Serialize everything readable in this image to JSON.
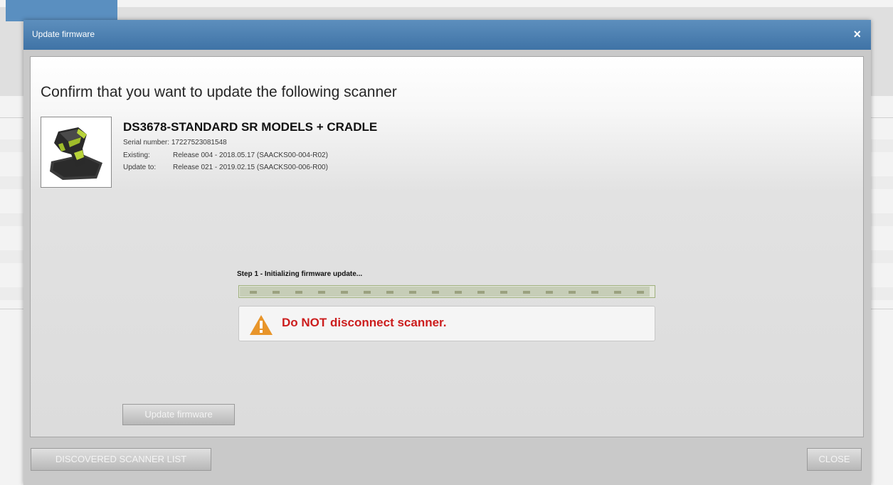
{
  "dialog": {
    "title": "Update firmware",
    "close_glyph": "×",
    "heading": "Confirm that you want to update the following scanner"
  },
  "scanner": {
    "image_icon": "barcode-scanner-icon",
    "model": "DS3678-STANDARD SR MODELS + CRADLE",
    "serial_label": "Serial number:",
    "serial_value": "17227523081548",
    "existing_label": "Existing:",
    "existing_value": "Release 004 - 2018.05.17 (SAACKS00-004-R02)",
    "update_to_label": "Update to:",
    "update_to_value": "Release 021 - 2019.02.15 (SAACKS00-006-R00)"
  },
  "progress": {
    "step_label": "Step 1 - Initializing firmware update...",
    "fraction": 0.99
  },
  "warning": {
    "icon": "warning-triangle-icon",
    "text": "Do NOT disconnect scanner."
  },
  "buttons": {
    "update_firmware": "Update firmware",
    "discovered_list": "DISCOVERED SCANNER LIST",
    "close": "CLOSE"
  },
  "colors": {
    "titlebar": "#4a7eb0",
    "warning_text": "#cc1d1d",
    "warning_icon": "#e8952a"
  }
}
